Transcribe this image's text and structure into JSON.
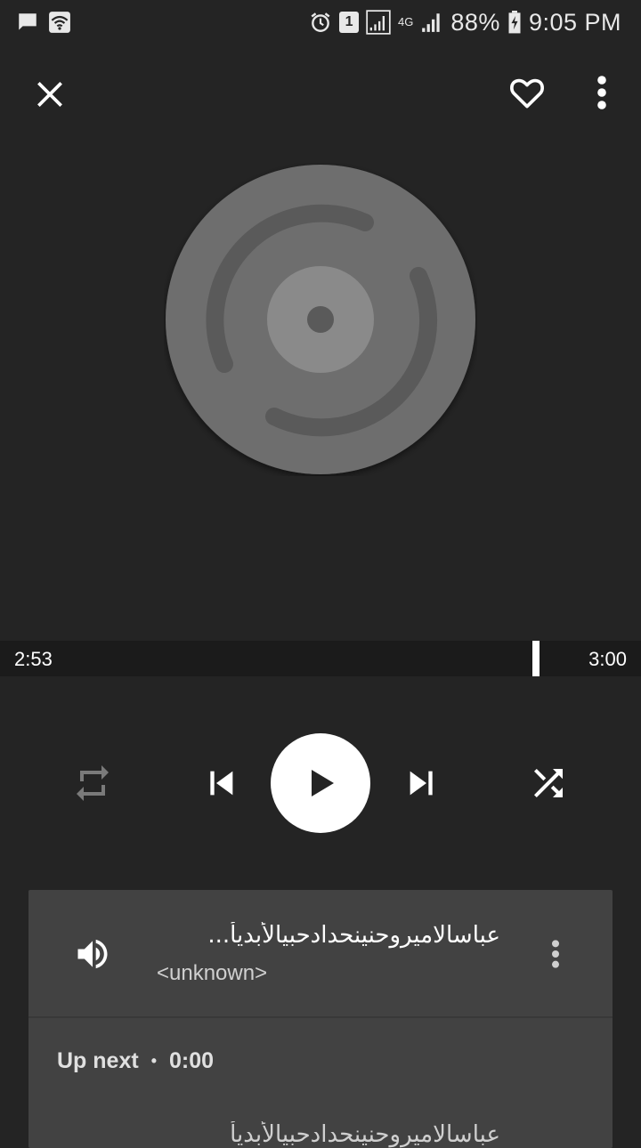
{
  "status_bar": {
    "sim_slot": "1",
    "network_type": "4G",
    "battery": "88%",
    "time": "9:05 PM",
    "icons": [
      "message-icon",
      "wifi-icon",
      "alarm-icon",
      "sim-icon",
      "signal-icon",
      "network-4g-icon",
      "signal-icon",
      "battery-icon"
    ]
  },
  "top_bar": {
    "icons": [
      "close-icon",
      "heart-icon",
      "more-vert-icon"
    ]
  },
  "player": {
    "album_art_icon": "disc-placeholder-icon",
    "elapsed": "2:53",
    "total": "3:00",
    "progress_fraction": 0.961,
    "controls": [
      "repeat-icon",
      "skip-previous-icon",
      "play-icon",
      "skip-next-icon",
      "shuffle-icon"
    ]
  },
  "queue": {
    "now_playing": {
      "icon": "volume-icon",
      "title": "عباسالاميروحنينحدادحبيالأبديأ...",
      "artist": "<unknown>"
    },
    "up_next_label": "Up next",
    "separator": "•",
    "up_next_duration": "0:00",
    "next_track_peek": "عباسالاميروحنينحدادحبيالأبديأ"
  },
  "colors": {
    "background": "#242424",
    "progress_strip": "#1b1b1b",
    "card": "#424242",
    "disc_outer": "#6e6e6e",
    "disc_inner": "#8a8a8a"
  }
}
